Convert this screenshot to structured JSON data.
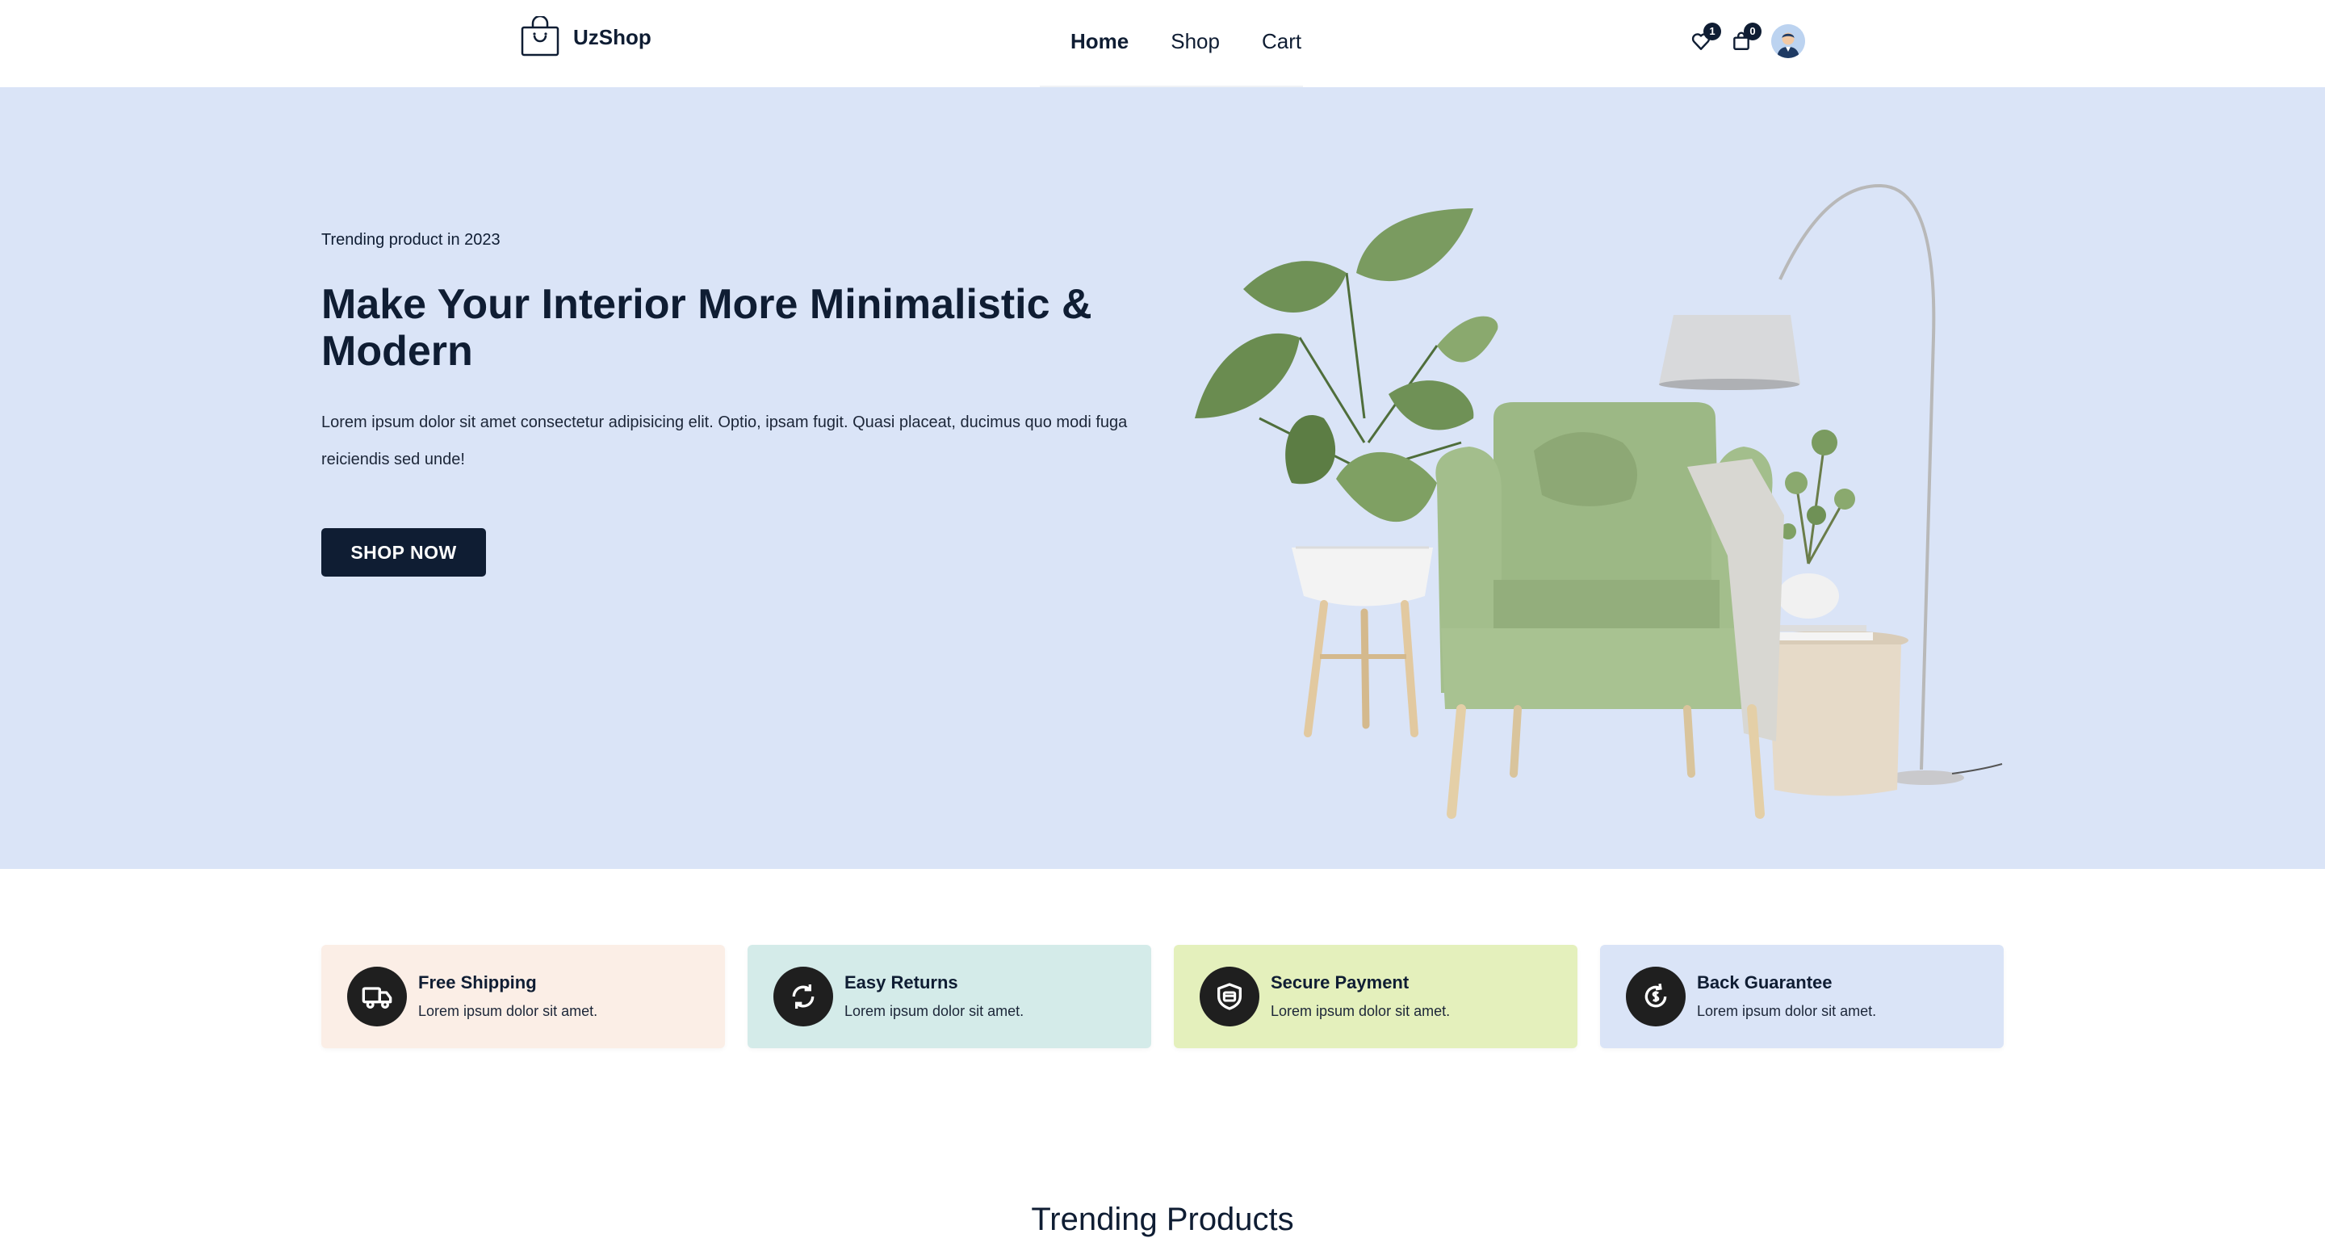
{
  "header": {
    "brand": "UzShop",
    "nav": [
      {
        "label": "Home",
        "active": true
      },
      {
        "label": "Shop",
        "active": false
      },
      {
        "label": "Cart",
        "active": false
      }
    ],
    "wishlist_count": "1",
    "cart_count": "0",
    "icons": [
      "shopping-bag-icon",
      "heart-icon",
      "cart-icon",
      "user-avatar"
    ]
  },
  "hero": {
    "subtitle": "Trending product in 2023",
    "title": "Make Your Interior More Minimalistic & Modern",
    "description": "Lorem ipsum dolor sit amet consectetur adipisicing elit. Optio, ipsam fugit. Quasi placeat, ducimus quo modi fuga reiciendis sed unde!",
    "button": "SHOP NOW",
    "background": "#dae4f7"
  },
  "features": [
    {
      "title": "Free Shipping",
      "desc": "Lorem ipsum dolor sit amet.",
      "icon": "truck-icon",
      "color": "#fbeee6"
    },
    {
      "title": "Easy Returns",
      "desc": "Lorem ipsum dolor sit amet.",
      "icon": "refresh-icon",
      "color": "#d4ebe9"
    },
    {
      "title": "Secure Payment",
      "desc": "Lorem ipsum dolor sit amet.",
      "icon": "secure-card-icon",
      "color": "#e4f0bc"
    },
    {
      "title": "Back Guarantee",
      "desc": "Lorem ipsum dolor sit amet.",
      "icon": "money-back-icon",
      "color": "#dae4f7"
    }
  ],
  "sections": {
    "trending_title": "Trending Products"
  },
  "colors": {
    "primary": "#0f1d33",
    "icon_circle": "#1f1f1f"
  }
}
